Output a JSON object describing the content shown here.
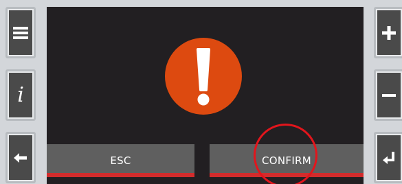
{
  "side_keys": {
    "left": [
      {
        "name": "menu",
        "icon": "hamburger-menu-icon"
      },
      {
        "name": "info",
        "icon": "info-icon",
        "glyph": "i"
      },
      {
        "name": "back",
        "icon": "arrow-left-icon"
      }
    ],
    "right": [
      {
        "name": "plus",
        "icon": "plus-icon"
      },
      {
        "name": "minus",
        "icon": "minus-icon"
      },
      {
        "name": "enter",
        "icon": "enter-return-icon"
      }
    ]
  },
  "dialog": {
    "icon": "exclamation-alert-icon",
    "esc_label": "ESC",
    "confirm_label": "CONFIRM"
  },
  "colors": {
    "alert": "#dd4a10",
    "button_bar": "#d22c2c",
    "screen_bg": "#221f22",
    "highlight_ring": "#e2151c"
  }
}
